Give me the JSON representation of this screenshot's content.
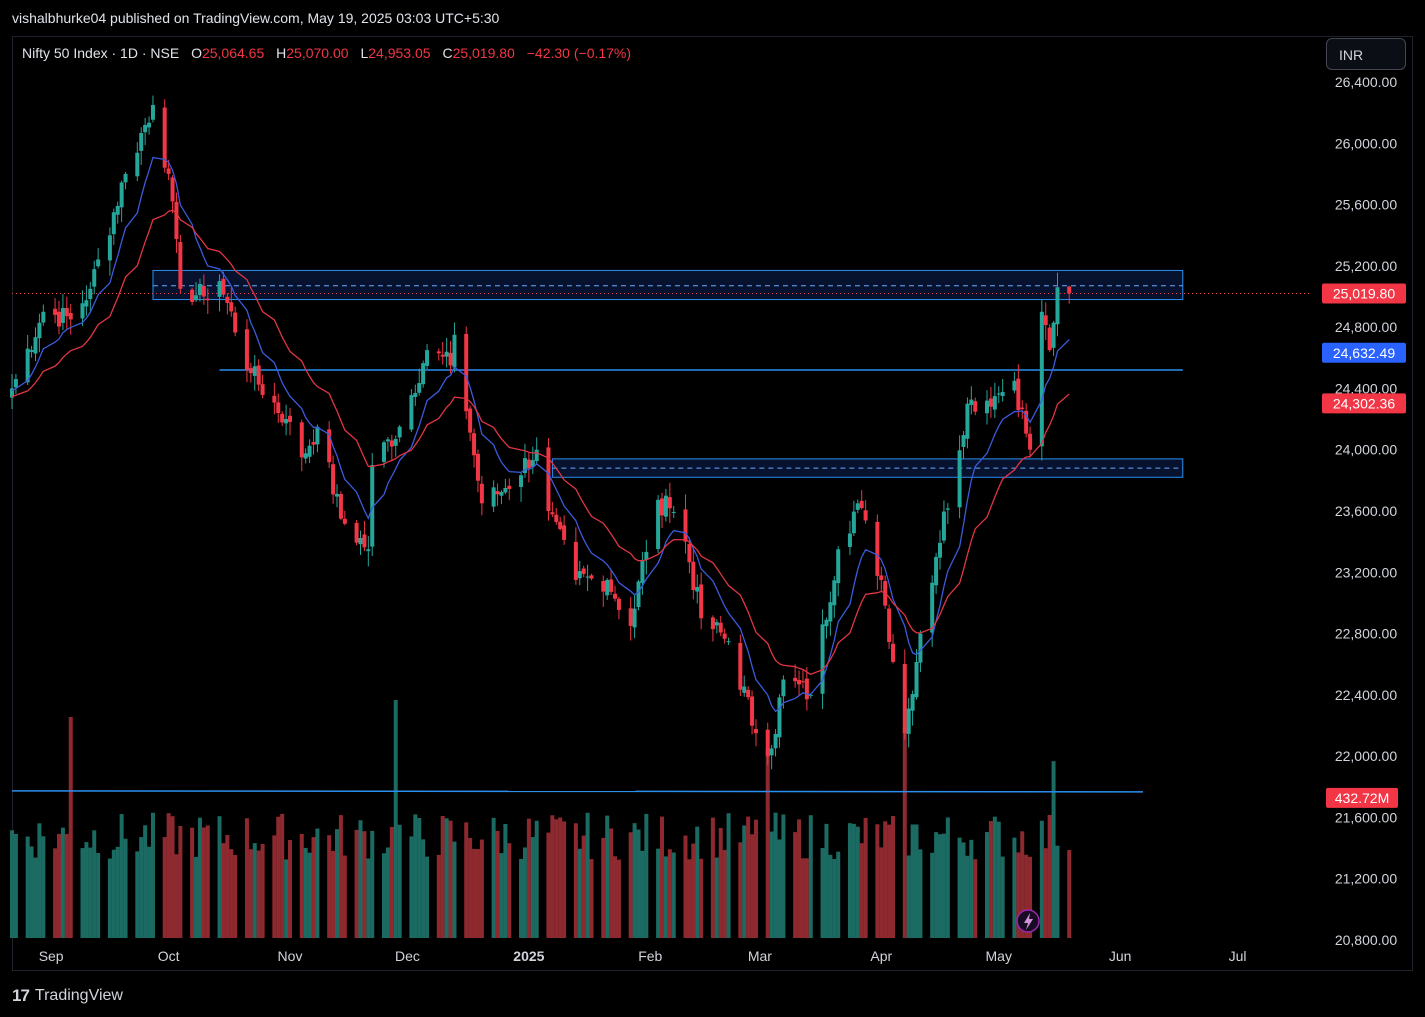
{
  "header": {
    "publish_line": "vishalbhurke04 published on TradingView.com, May 19, 2025 03:03 UTC+5:30"
  },
  "legend": {
    "symbol": "Nifty 50 Index · 1D · NSE",
    "open_key": "O",
    "open": "25,064.65",
    "high_key": "H",
    "high": "25,070.00",
    "low_key": "L",
    "low": "24,953.05",
    "close_key": "C",
    "close": "25,019.80",
    "change": "−42.30 (−0.17%)"
  },
  "currency_button": {
    "label": "INR"
  },
  "footer": {
    "logo_mark": "17",
    "brand": "TradingView"
  },
  "colors": {
    "up": "#26a69a",
    "down": "#f23645",
    "ema_fast": "#3b5bdb",
    "ema_slow": "#e03544",
    "zone_line": "#2a8ff0",
    "volume_up": "#1b6b63",
    "volume_down": "#8e2a2f",
    "axis_text": "#d1d4dc",
    "tag_last": "#f23645",
    "tag_blue": "#2962ff"
  },
  "chart_data": {
    "type": "candlestick",
    "title": "Nifty 50 Index · 1D · NSE",
    "currency": "INR",
    "ylim": [
      20800,
      26700
    ],
    "yticks": [
      {
        "value": 26400,
        "label": "26,400.00"
      },
      {
        "value": 26000,
        "label": "26,000.00"
      },
      {
        "value": 25600,
        "label": "25,600.00"
      },
      {
        "value": 25200,
        "label": "25,200.00"
      },
      {
        "value": 24800,
        "label": "24,800.00"
      },
      {
        "value": 24400,
        "label": "24,400.00"
      },
      {
        "value": 24000,
        "label": "24,000.00"
      },
      {
        "value": 23600,
        "label": "23,600.00"
      },
      {
        "value": 23200,
        "label": "23,200.00"
      },
      {
        "value": 22800,
        "label": "22,800.00"
      },
      {
        "value": 22400,
        "label": "22,400.00"
      },
      {
        "value": 22000,
        "label": "22,000.00"
      },
      {
        "value": 21600,
        "label": "21,600.00"
      },
      {
        "value": 21200,
        "label": "21,200.00"
      },
      {
        "value": 20800,
        "label": "20,800.00"
      }
    ],
    "x_range": [
      "2024-08-22",
      "2025-07-20"
    ],
    "xticks": [
      {
        "date": "2024-09-01",
        "label": "Sep"
      },
      {
        "date": "2024-10-01",
        "label": "Oct"
      },
      {
        "date": "2024-11-01",
        "label": "Nov"
      },
      {
        "date": "2024-12-01",
        "label": "Dec"
      },
      {
        "date": "2025-01-01",
        "label": "2025"
      },
      {
        "date": "2025-02-01",
        "label": "Feb"
      },
      {
        "date": "2025-03-01",
        "label": "Mar"
      },
      {
        "date": "2025-04-01",
        "label": "Apr"
      },
      {
        "date": "2025-05-01",
        "label": "May"
      },
      {
        "date": "2025-06-01",
        "label": "Jun"
      },
      {
        "date": "2025-07-01",
        "label": "Jul"
      }
    ],
    "anchors": [
      {
        "date": "2024-08-22",
        "close": 24400
      },
      {
        "date": "2024-08-30",
        "close": 24900
      },
      {
        "date": "2024-09-06",
        "close": 24850
      },
      {
        "date": "2024-09-11",
        "close": 25050
      },
      {
        "date": "2024-09-20",
        "close": 25800
      },
      {
        "date": "2024-09-27",
        "close": 26250
      },
      {
        "date": "2024-10-01",
        "close": 25800
      },
      {
        "date": "2024-10-04",
        "close": 25050
      },
      {
        "date": "2024-10-10",
        "close": 25000
      },
      {
        "date": "2024-10-14",
        "close": 25100
      },
      {
        "date": "2024-10-22",
        "close": 24500
      },
      {
        "date": "2024-10-31",
        "close": 24200
      },
      {
        "date": "2024-11-04",
        "close": 23950
      },
      {
        "date": "2024-11-08",
        "close": 24150
      },
      {
        "date": "2024-11-14",
        "close": 23550
      },
      {
        "date": "2024-11-21",
        "close": 23350
      },
      {
        "date": "2024-11-22",
        "close": 23900
      },
      {
        "date": "2024-11-29",
        "close": 24150
      },
      {
        "date": "2024-12-06",
        "close": 24650
      },
      {
        "date": "2024-12-12",
        "close": 24550
      },
      {
        "date": "2024-12-13",
        "close": 24750
      },
      {
        "date": "2024-12-20",
        "close": 23650
      },
      {
        "date": "2024-12-26",
        "close": 23750
      },
      {
        "date": "2025-01-03",
        "close": 24000
      },
      {
        "date": "2025-01-06",
        "close": 23600
      },
      {
        "date": "2025-01-13",
        "close": 23150
      },
      {
        "date": "2025-01-21",
        "close": 23150
      },
      {
        "date": "2025-01-27",
        "close": 22850
      },
      {
        "date": "2025-02-01",
        "close": 23500
      },
      {
        "date": "2025-02-05",
        "close": 23700
      },
      {
        "date": "2025-02-10",
        "close": 23400
      },
      {
        "date": "2025-02-14",
        "close": 22900
      },
      {
        "date": "2025-02-21",
        "close": 22750
      },
      {
        "date": "2025-02-28",
        "close": 22150
      },
      {
        "date": "2025-03-04",
        "close": 22050
      },
      {
        "date": "2025-03-07",
        "close": 22500
      },
      {
        "date": "2025-03-14",
        "close": 22400
      },
      {
        "date": "2025-03-21",
        "close": 23350
      },
      {
        "date": "2025-03-26",
        "close": 23650
      },
      {
        "date": "2025-04-01",
        "close": 23150
      },
      {
        "date": "2025-04-07",
        "close": 22150
      },
      {
        "date": "2025-04-11",
        "close": 22800
      },
      {
        "date": "2025-04-15",
        "close": 23300
      },
      {
        "date": "2025-04-23",
        "close": 24300
      },
      {
        "date": "2025-04-30",
        "close": 24350
      },
      {
        "date": "2025-05-05",
        "close": 24450
      },
      {
        "date": "2025-05-09",
        "close": 24000
      },
      {
        "date": "2025-05-12",
        "close": 24900
      },
      {
        "date": "2025-05-14",
        "close": 24650
      },
      {
        "date": "2025-05-16",
        "close": 25060
      },
      {
        "date": "2025-05-19",
        "close": 25019.8
      }
    ],
    "last_bar": {
      "date": "2025-05-19",
      "open": 25064.65,
      "high": 25070.0,
      "low": 24953.05,
      "close": 25019.8,
      "change": -42.3,
      "change_pct": -0.17
    },
    "moving_averages": [
      {
        "type": "ema",
        "length": 9,
        "color": "#3b5bdb",
        "last": 24632.49,
        "label": "24,632.49"
      },
      {
        "type": "ema",
        "length": 21,
        "color": "#e03544",
        "last": 24302.36,
        "label": "24,302.36"
      }
    ],
    "zones": [
      {
        "top": 25170,
        "bottom": 24980,
        "mid": 25070,
        "start": "2024-09-27",
        "end": "2025-06-17"
      },
      {
        "top": 23940,
        "bottom": 23820,
        "mid": 23880,
        "start": "2025-01-07",
        "end": "2025-06-17"
      }
    ],
    "horizontal_lines": [
      {
        "price": 24520,
        "start": "2024-10-14",
        "end": "2025-06-17"
      }
    ],
    "volume": {
      "level_line": 432.72,
      "level_label": "432.72M",
      "max": 700,
      "peaks": [
        {
          "date": "2024-09-06",
          "value": 650
        },
        {
          "date": "2024-11-28",
          "value": 700
        },
        {
          "date": "2025-03-03",
          "value": 560
        },
        {
          "date": "2025-04-07",
          "value": 620
        },
        {
          "date": "2025-05-15",
          "value": 520
        }
      ]
    },
    "price_tags": [
      {
        "price": 25019.8,
        "label": "25,019.80",
        "role": "last"
      },
      {
        "price": 24632.49,
        "label": "24,632.49",
        "role": "ema_fast"
      },
      {
        "price": 24302.36,
        "label": "24,302.36",
        "role": "ema_slow"
      }
    ]
  }
}
